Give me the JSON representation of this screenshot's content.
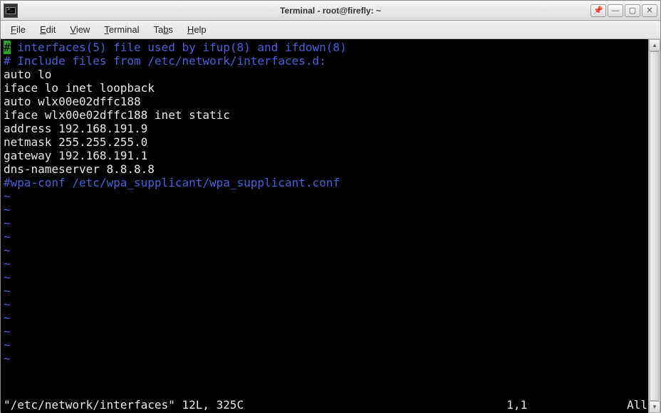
{
  "window": {
    "title": "Terminal - root@firefly: ~"
  },
  "menu": {
    "file": "File",
    "edit": "Edit",
    "view": "View",
    "terminal": "Terminal",
    "tabs": "Tabs",
    "help": "Help"
  },
  "editor": {
    "lines": [
      {
        "text": "# interfaces(5) file used by ifup(8) and ifdown(8)",
        "style": "comment",
        "cursor_first": true
      },
      {
        "text": "# Include files from /etc/network/interfaces.d:",
        "style": "comment"
      },
      {
        "text": "auto lo",
        "style": "normal"
      },
      {
        "text": "iface lo inet loopback",
        "style": "normal"
      },
      {
        "text": "",
        "style": "normal"
      },
      {
        "text": "auto wlx00e02dffc188",
        "style": "normal"
      },
      {
        "text": "iface wlx00e02dffc188 inet static",
        "style": "normal"
      },
      {
        "text": "address 192.168.191.9",
        "style": "normal"
      },
      {
        "text": "netmask 255.255.255.0",
        "style": "normal"
      },
      {
        "text": "gateway 192.168.191.1",
        "style": "normal"
      },
      {
        "text": "dns-nameserver 8.8.8.8",
        "style": "normal"
      },
      {
        "text": "#wpa-conf /etc/wpa_supplicant/wpa_supplicant.conf",
        "style": "comment"
      }
    ],
    "tilde_count": 13
  },
  "status": {
    "file": "\"/etc/network/interfaces\" 12L, 325C",
    "position": "1,1",
    "percent": "All"
  },
  "icons": {
    "pin": "📌",
    "minimize": "—",
    "maximize": "▢",
    "close": "✕",
    "scroll_up": "▴",
    "scroll_down": "▾"
  }
}
